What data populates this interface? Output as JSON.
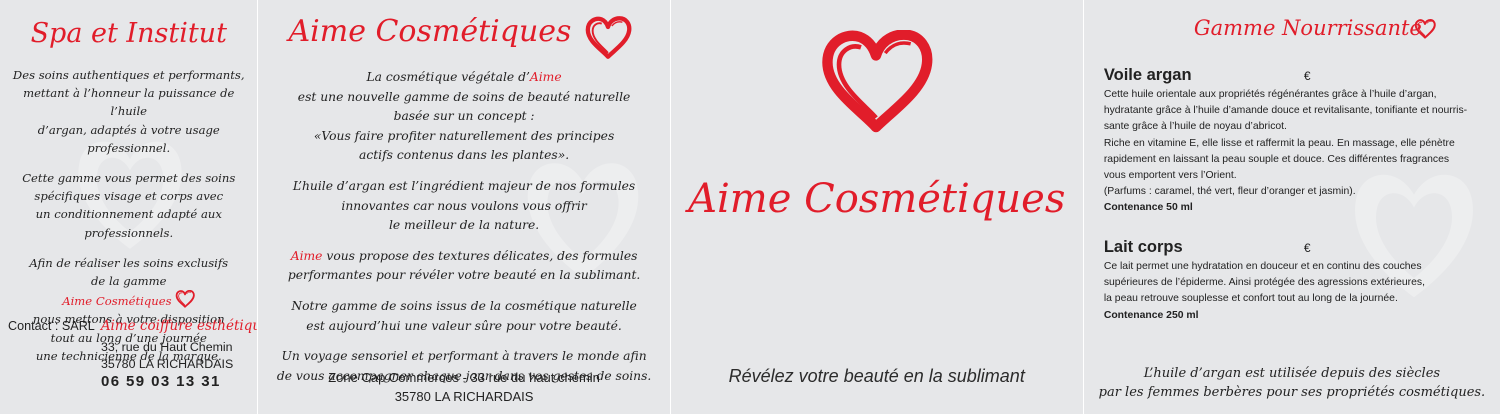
{
  "colors": {
    "accent": "#e11d2a",
    "background": "#e6e7e9",
    "text": "#222222"
  },
  "panel1": {
    "title": "Spa et Institut",
    "paragraphs": [
      [
        "Des soins authentiques et performants,",
        "mettant à l’honneur la puissance de l’huile",
        "d’argan, adaptés à votre usage professionnel."
      ],
      [
        "Cette gamme vous permet des soins",
        "spécifiques visage et corps avec",
        "un conditionnement adapté aux professionnels."
      ],
      [
        "Afin de réaliser les soins exclusifs",
        "de la gamme"
      ]
    ],
    "brand_inline": "Aime Cosmétiques",
    "after_brand": [
      "nous mettons à votre disposition",
      "tout au long d’une journée",
      "une technicienne de la marque."
    ],
    "contact_label": "Contact : SARL",
    "contact_company": "Aime coiffure esthétique",
    "address_line1": "33, rue du Haut Chemin",
    "address_line2": "35780 LA RICHARDAIS",
    "phone": "06 59 03 13 31"
  },
  "panel2": {
    "title": "Aime Cosmétiques",
    "para1_pre": "La cosmétique végétale d’",
    "para1_brand": "Aime",
    "para1_lines": [
      "est une nouvelle gamme de soins de beauté naturelle",
      "basée sur un concept :",
      "«Vous faire profiter naturellement des principes",
      "actifs contenus dans les plantes»."
    ],
    "para2": [
      "L’huile d’argan est l’ingrédient majeur de nos formules",
      "innovantes car nous voulons vous offrir",
      "le meilleur de la nature."
    ],
    "para3_brand": "Aime",
    "para3_first": " vous propose des textures délicates, des formules",
    "para3_rest": "performantes pour révéler votre beauté en la sublimant.",
    "para4": [
      "Notre gamme de soins issus de la cosmétique naturelle",
      "est aujourd’hui une valeur sûre pour votre beauté."
    ],
    "para5": [
      "Un voyage sensoriel et performant à travers le monde afin",
      "de vous accompagner chaque jour dans vos gestes de soins."
    ],
    "footer_line1": "Zone Cap Commerces - 33 rue du haut chemin",
    "footer_line2": "35780 LA RICHARDAIS"
  },
  "panel3": {
    "brand": "Aime Cosmétiques",
    "tagline": "Révélez votre beauté en la sublimant"
  },
  "panel4": {
    "title": "Gamme Nourrissante",
    "products": [
      {
        "name": "Voile argan",
        "currency": "€",
        "description": [
          "Cette huile orientale aux propriétés régénérantes grâce à l’huile d’argan,",
          "hydratante grâce à l’huile d’amande douce et revitalisante, tonifiante et nourris-",
          "sante grâce à l’huile de noyau d’abricot.",
          "Riche en vitamine E, elle lisse et raffermit la peau. En massage, elle pénètre",
          "rapidement en laissant la peau souple et douce. Ces différentes fragrances",
          "vous emportent vers l’Orient.",
          "(Parfums : caramel, thé vert, fleur d’oranger et jasmin)."
        ],
        "capacity": "Contenance 50 ml"
      },
      {
        "name": "Lait corps",
        "currency": "€",
        "description": [
          "Ce lait permet une hydratation en douceur et en continu des couches",
          "supérieures de l’épiderme. Ainsi protégée des agressions extérieures,",
          "la peau retrouve souplesse et confort tout au long de la journée."
        ],
        "capacity": "Contenance 250 ml"
      }
    ],
    "quote_line1": "L’huile d’argan est utilisée depuis des siècles",
    "quote_line2": "par les femmes berbères pour ses propriétés cosmétiques."
  },
  "icons": {
    "heart": "heart-icon",
    "watermark": "heart-watermark-icon"
  }
}
